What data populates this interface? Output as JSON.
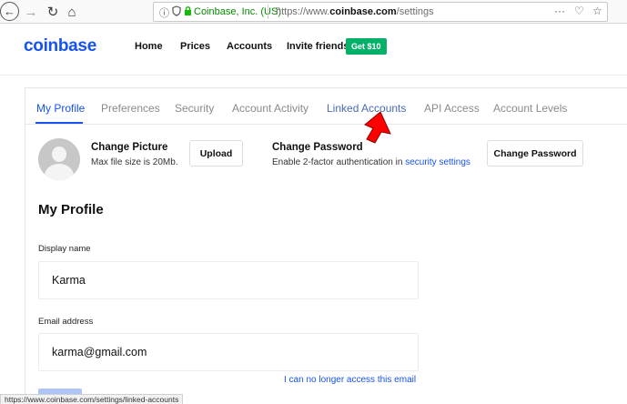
{
  "browser": {
    "back_glyph": "←",
    "forward_glyph": "→",
    "reload_glyph": "↻",
    "home_glyph": "⌂",
    "site_identity": "Coinbase, Inc. (US)",
    "url_prefix": "https://www.",
    "url_domain": "coinbase.com",
    "url_path": "/settings",
    "menu_glyph": "···",
    "bookmark_glyph": "♡",
    "star_glyph": "☆"
  },
  "header": {
    "logo": "coinbase",
    "nav": [
      "Home",
      "Prices",
      "Accounts",
      "Invite friends"
    ],
    "invite_badge": "Get $10"
  },
  "tabs": [
    {
      "label": "My Profile",
      "active": true
    },
    {
      "label": "Preferences",
      "active": false
    },
    {
      "label": "Security",
      "active": false
    },
    {
      "label": "Account Activity",
      "active": false
    },
    {
      "label": "Linked Accounts",
      "active": false
    },
    {
      "label": "API Access",
      "active": false
    },
    {
      "label": "Account Levels",
      "active": false
    }
  ],
  "picture": {
    "title": "Change Picture",
    "hint": "Max file size is 20Mb.",
    "upload_label": "Upload"
  },
  "password": {
    "title": "Change Password",
    "hint_prefix": "Enable 2-factor authentication in",
    "hint_link": "security settings",
    "button_label": "Change Password"
  },
  "profile": {
    "section_title": "My Profile",
    "display_name_label": "Display name",
    "display_name_value": "Karma",
    "email_label": "Email address",
    "email_value": "karma@gmail.com",
    "email_help_link": "I can no longer access this email"
  },
  "status_bar": "https://www.coinbase.com/settings/linked-accounts",
  "colors": {
    "brand_blue": "#1652f0",
    "badge_green": "#05b169",
    "annotation_red": "#ff0000"
  }
}
